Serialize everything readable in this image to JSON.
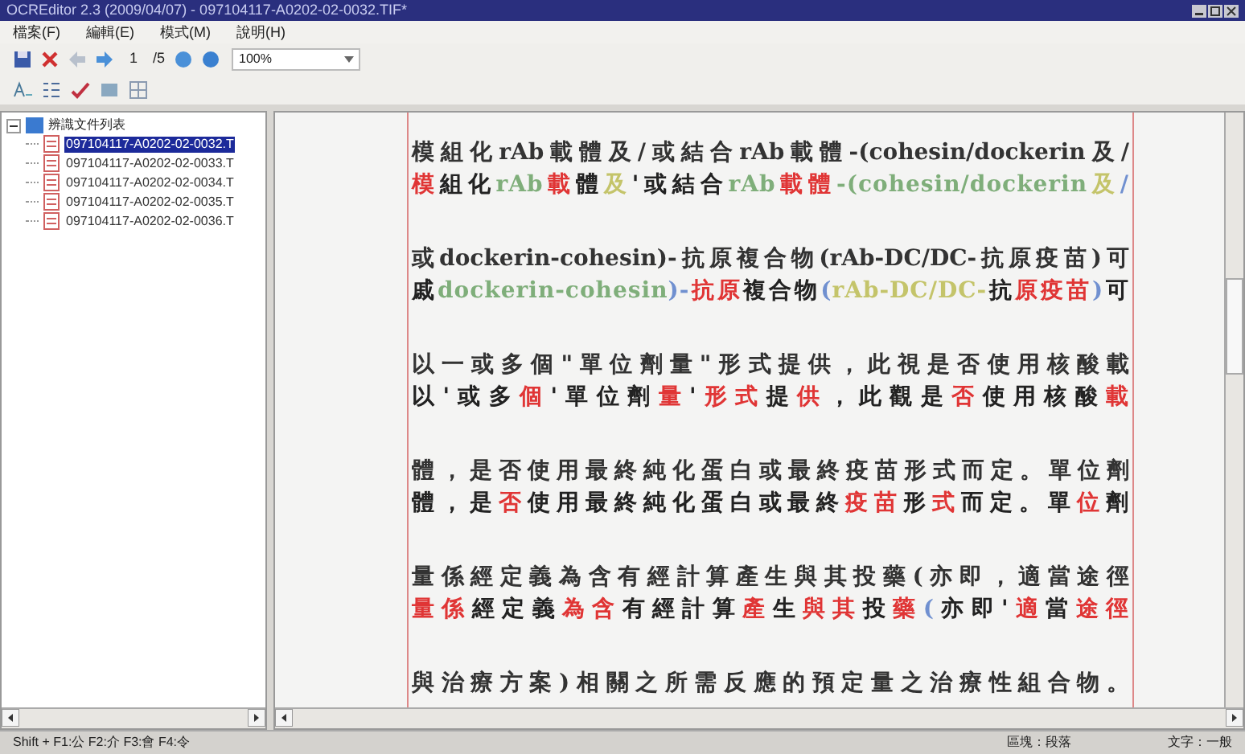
{
  "window": {
    "title": "OCREditor 2.3 (2009/04/07) - 097104117-A0202-02-0032.TIF*"
  },
  "menu": [
    "檔案(F)",
    "編輯(E)",
    "模式(M)",
    "說明(H)"
  ],
  "toolbar": {
    "page": "1",
    "page_count": "/5",
    "zoom": "100%"
  },
  "tree": {
    "label": "辨識文件列表",
    "expanded": true,
    "children": [
      {
        "label": "097104117-A0202-02-0032.T",
        "selected": true
      },
      {
        "label": "097104117-A0202-02-0033.T",
        "selected": false
      },
      {
        "label": "097104117-A0202-02-0034.T",
        "selected": false
      },
      {
        "label": "097104117-A0202-02-0035.T",
        "selected": false
      },
      {
        "label": "097104117-A0202-02-0036.T",
        "selected": false
      }
    ]
  },
  "document": {
    "lines": [
      {
        "source": "模組化rAb載體及/或結合rAb載體-(cohesin/dockerin及/",
        "ocr": [
          {
            "text": "模",
            "color": "#e03535"
          },
          {
            "text": "組化",
            "color": "#222222"
          },
          {
            "text": "rAb",
            "color": "#7fae7a"
          },
          {
            "text": "載",
            "color": "#e03535"
          },
          {
            "text": "體",
            "color": "#222222"
          },
          {
            "text": "及",
            "color": "#c4c46a"
          },
          {
            "text": "'或結合",
            "color": "#222222"
          },
          {
            "text": "rAb",
            "color": "#7fae7a"
          },
          {
            "text": "載體",
            "color": "#e03535"
          },
          {
            "text": "-(cohesin/dockerin",
            "color": "#7fae7a"
          },
          {
            "text": "及",
            "color": "#c4c46a"
          },
          {
            "text": "/",
            "color": "#7090d0"
          }
        ]
      },
      {
        "source": "或dockerin-cohesin)-抗原複合物(rAb-DC/DC-抗原疫苗)可",
        "ocr": [
          {
            "text": "戚",
            "color": "#222222"
          },
          {
            "text": "dockerin-cohesin",
            "color": "#7fae7a"
          },
          {
            "text": ")-",
            "color": "#7090d0"
          },
          {
            "text": "抗原",
            "color": "#e03535"
          },
          {
            "text": "複合物",
            "color": "#222222"
          },
          {
            "text": "(",
            "color": "#7090d0"
          },
          {
            "text": "rAb-DC/DC-",
            "color": "#c4c46a"
          },
          {
            "text": "抗",
            "color": "#222222"
          },
          {
            "text": "原疫苗",
            "color": "#e03535"
          },
          {
            "text": ")",
            "color": "#7090d0"
          },
          {
            "text": "可",
            "color": "#222222"
          }
        ]
      },
      {
        "source": "以一或多個\"單位劑量\"形式提供，此視是否使用核酸載",
        "ocr": [
          {
            "text": "以'或多",
            "color": "#222222"
          },
          {
            "text": "個",
            "color": "#e03535"
          },
          {
            "text": "'單位劑",
            "color": "#222222"
          },
          {
            "text": "量",
            "color": "#e03535"
          },
          {
            "text": "'",
            "color": "#222222"
          },
          {
            "text": "形式",
            "color": "#e03535"
          },
          {
            "text": "提",
            "color": "#222222"
          },
          {
            "text": "供",
            "color": "#e03535"
          },
          {
            "text": "，此觀是",
            "color": "#222222"
          },
          {
            "text": "否",
            "color": "#e03535"
          },
          {
            "text": "使用核酸",
            "color": "#222222"
          },
          {
            "text": "載",
            "color": "#e03535"
          }
        ]
      },
      {
        "source": "體，是否使用最終純化蛋白或最終疫苗形式而定。單位劑",
        "ocr": [
          {
            "text": "體，是",
            "color": "#222222"
          },
          {
            "text": "否",
            "color": "#e03535"
          },
          {
            "text": "使用最終純化蛋白或最終",
            "color": "#222222"
          },
          {
            "text": "疫苗",
            "color": "#e03535"
          },
          {
            "text": "形",
            "color": "#222222"
          },
          {
            "text": "式",
            "color": "#e03535"
          },
          {
            "text": "而定。單",
            "color": "#222222"
          },
          {
            "text": "位",
            "color": "#e03535"
          },
          {
            "text": "劑",
            "color": "#222222"
          }
        ]
      },
      {
        "source": "量係經定義為含有經計算產生與其投藥(亦即，適當途徑",
        "ocr": [
          {
            "text": "量係",
            "color": "#e03535"
          },
          {
            "text": "經定義",
            "color": "#222222"
          },
          {
            "text": "為含",
            "color": "#e03535"
          },
          {
            "text": "有經計算",
            "color": "#222222"
          },
          {
            "text": "產",
            "color": "#e03535"
          },
          {
            "text": "生",
            "color": "#222222"
          },
          {
            "text": "與其",
            "color": "#e03535"
          },
          {
            "text": "投",
            "color": "#222222"
          },
          {
            "text": "藥",
            "color": "#e03535"
          },
          {
            "text": "(",
            "color": "#7090d0"
          },
          {
            "text": "亦即'",
            "color": "#222222"
          },
          {
            "text": "適",
            "color": "#e03535"
          },
          {
            "text": "當",
            "color": "#222222"
          },
          {
            "text": "途徑",
            "color": "#e03535"
          }
        ]
      },
      {
        "source": "與治療方案)相關之所需反應的預定量之治療性組合物。"
      }
    ]
  },
  "status_bar": {
    "keys": "Shift + F1:公 F2:介 F3:會 F4:令",
    "block": "區塊：段落",
    "text": "文字：一般"
  }
}
